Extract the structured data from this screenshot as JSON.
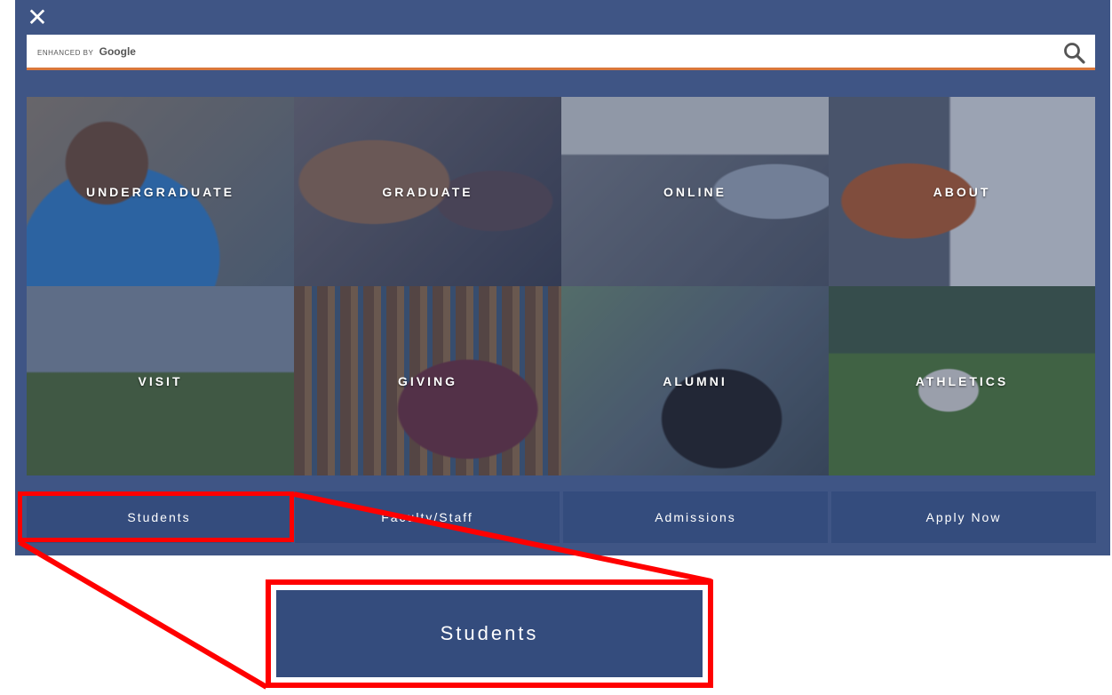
{
  "overlay": {
    "close_glyph": "✕",
    "search": {
      "enhanced_by": "ENHANCED BY",
      "brand": "Google",
      "placeholder": "",
      "value": ""
    }
  },
  "tiles": [
    {
      "label": "UNDERGRADUATE"
    },
    {
      "label": "GRADUATE"
    },
    {
      "label": "ONLINE"
    },
    {
      "label": "ABOUT"
    },
    {
      "label": "VISIT"
    },
    {
      "label": "GIVING"
    },
    {
      "label": "ALUMNI"
    },
    {
      "label": "ATHLETICS"
    }
  ],
  "bottom_nav": [
    {
      "label": "Students"
    },
    {
      "label": "Faculty/Staff"
    },
    {
      "label": "Admissions"
    },
    {
      "label": "Apply Now"
    }
  ],
  "zoom_callout": {
    "label": "Students"
  },
  "colors": {
    "panel": "#3f5585",
    "nav_button": "#344c7d",
    "search_underline": "#d9773b",
    "highlight": "#ff0000"
  }
}
